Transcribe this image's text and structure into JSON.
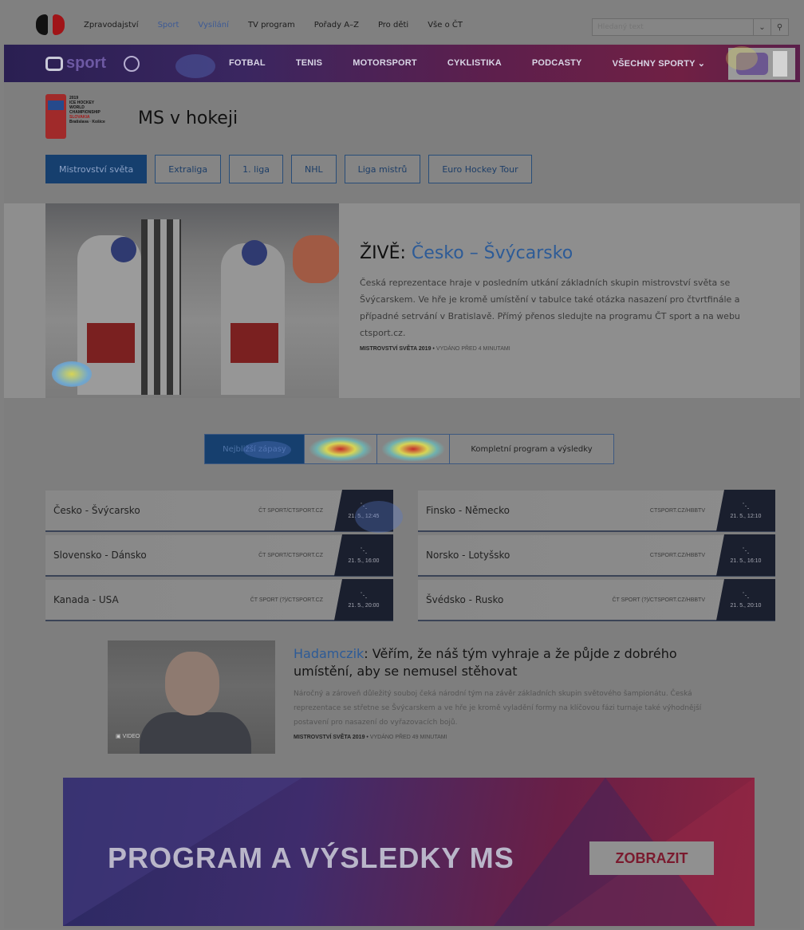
{
  "topnav": {
    "items": [
      "Zpravodajství",
      "Sport",
      "Vysílání",
      "TV program",
      "Pořady A–Z",
      "Pro děti",
      "Vše o ČT"
    ],
    "search_placeholder": "Hledaný text"
  },
  "sportnav": {
    "logo": "sport",
    "items": [
      "FOTBAL",
      "TENIS",
      "MOTORSPORT",
      "CYKLISTIKA",
      "PODCASTY",
      "VŠECHNY SPORTY"
    ]
  },
  "header": {
    "logo_lines": [
      "2019",
      "ICE HOCKEY",
      "WORLD",
      "CHAMPIONSHIP",
      "SLOVAKIA",
      "Bratislava · Košice"
    ],
    "title": "MS v hokeji"
  },
  "tabs": [
    "Mistrovství světa",
    "Extraliga",
    "1. liga",
    "NHL",
    "Liga mistrů",
    "Euro Hockey Tour"
  ],
  "hero": {
    "title_prefix": "ŽIVĚ: ",
    "title_live": "Česko – Švýcarsko",
    "description": "Česká reprezentace hraje v posledním utkání základních skupin mistrovství světa se Švýcarskem. Ve hře je kromě umístění v tabulce také otázka nasazení pro čtvrtfinále a případné setrvání v Bratislavě. Přímý přenos sledujte na programu ČT sport a na webu ctsport.cz.",
    "meta_section": "MISTROVSTVÍ SVĚTA 2019",
    "meta_time": "VYDÁNO PŘED 4 MINUTAMI"
  },
  "segments": [
    "Nejbližší zápasy",
    "",
    "",
    "Kompletní program a výsledky"
  ],
  "matches": [
    {
      "teams": "Česko - Švýcarsko",
      "channel": "ČT SPORT/CTSPORT.CZ",
      "time": "21. 5., 12:45"
    },
    {
      "teams": "Finsko - Německo",
      "channel": "CTSPORT.CZ/HBBTV",
      "time": "21. 5., 12:10"
    },
    {
      "teams": "Slovensko - Dánsko",
      "channel": "ČT SPORT/CTSPORT.CZ",
      "time": "21. 5., 16:00"
    },
    {
      "teams": "Norsko - Lotyšsko",
      "channel": "CTSPORT.CZ/HBBTV",
      "time": "21. 5., 16:10"
    },
    {
      "teams": "Kanada - USA",
      "channel": "ČT SPORT (?)/CTSPORT.CZ",
      "time": "21. 5., 20:00"
    },
    {
      "teams": "Švédsko - Rusko",
      "channel": "ČT SPORT (?)/CTSPORT.CZ/HBBTV",
      "time": "21. 5., 20:10"
    }
  ],
  "article": {
    "video_label": "VIDEO",
    "title_prefix": "Hadamczik",
    "title_rest": ": Věřím, že náš tým vyhraje a že půjde z dobrého umístění, aby se nemusel stěhovat",
    "description": "Náročný a zároveň důležitý souboj čeká národní tým na závěr základních skupin světového šampionátu. Česká reprezentace se střetne se Švýcarskem a ve hře je kromě vyladění formy na klíčovou fázi turnaje také výhodnější postavení pro nasazení do vyřazovacích bojů.",
    "meta_section": "MISTROVSTVÍ SVĚTA 2019",
    "meta_time": "VYDÁNO PŘED 49 MINUTAMI"
  },
  "banner": {
    "text": "PROGRAM A VÝSLEDKY MS",
    "button": "ZOBRAZIT"
  }
}
